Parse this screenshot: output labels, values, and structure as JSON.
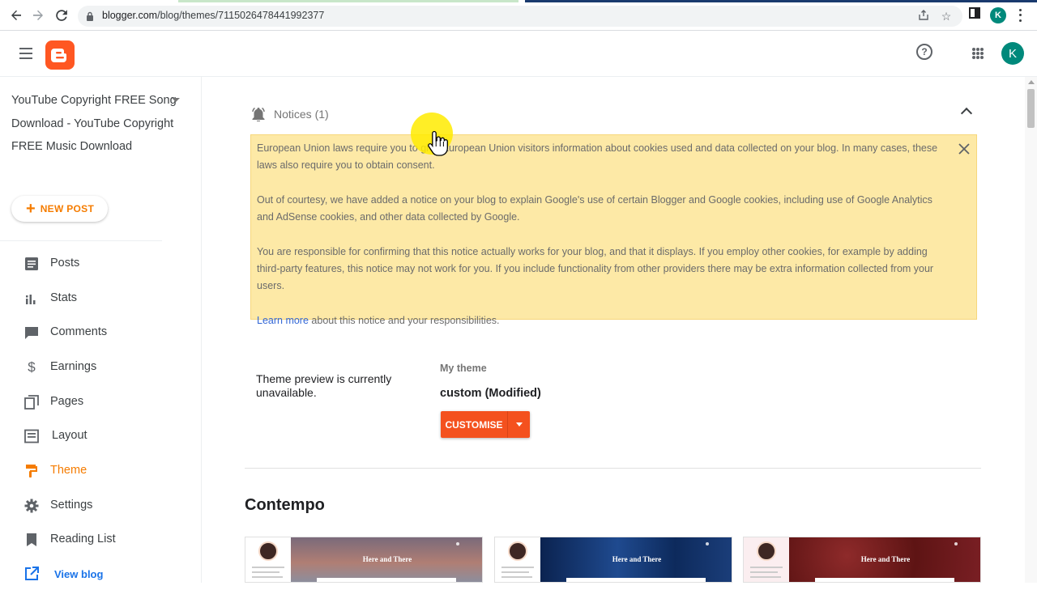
{
  "browser": {
    "url_host": "blogger.com",
    "url_path": "/blog/themes/7115026478441992377",
    "profile_initial": "K"
  },
  "header": {
    "account_initial": "K"
  },
  "sidebar": {
    "blog_title": "YouTube Copyright FREE Song Download - YouTube Copyright FREE Music Download",
    "new_post_label": "NEW POST",
    "items": [
      {
        "label": "Posts",
        "icon": "posts-icon"
      },
      {
        "label": "Stats",
        "icon": "stats-icon"
      },
      {
        "label": "Comments",
        "icon": "comments-icon"
      },
      {
        "label": "Earnings",
        "icon": "dollar-icon"
      },
      {
        "label": "Pages",
        "icon": "pages-icon"
      },
      {
        "label": "Layout",
        "icon": "layout-icon"
      },
      {
        "label": "Theme",
        "icon": "theme-icon",
        "active": true
      },
      {
        "label": "Settings",
        "icon": "gear-icon"
      },
      {
        "label": "Reading List",
        "icon": "bookmark-icon"
      }
    ],
    "view_blog_label": "View blog"
  },
  "notices": {
    "title": "Notices (1)",
    "paragraphs": [
      "European Union laws require you to give European Union visitors information about cookies used and data collected on your blog. In many cases, these laws also require you to obtain consent.",
      "Out of courtesy, we have added a notice on your blog to explain Google's use of certain Blogger and Google cookies, including use of Google Analytics and AdSense cookies, and other data collected by Google.",
      "You are responsible for confirming that this notice actually works for your blog, and that it displays. If you employ other cookies, for example by adding third-party features, this notice may not work for you. If you include functionality from other providers there may be extra information collected from your users."
    ],
    "learn_more_link": "Learn more",
    "learn_more_suffix": " about this notice and your responsibilities."
  },
  "theme": {
    "preview_unavailable": "Theme preview is currently unavailable.",
    "my_theme_label": "My theme",
    "name": "custom (Modified)",
    "customise_label": "CUSTOMISE"
  },
  "gallery": {
    "section_title": "Contempo",
    "thumbnails": [
      {
        "hero_title": "Here and There",
        "hero_color": "#8d6e63"
      },
      {
        "hero_title": "Here and There",
        "hero_color": "#0d2a5c"
      },
      {
        "hero_title": "Here and There",
        "hero_color": "#6d1b1b"
      }
    ]
  },
  "colors": {
    "accent": "#f57c00",
    "customise_button": "#f4511e",
    "notice_bg": "#fde9a6",
    "link": "#3367d6"
  }
}
